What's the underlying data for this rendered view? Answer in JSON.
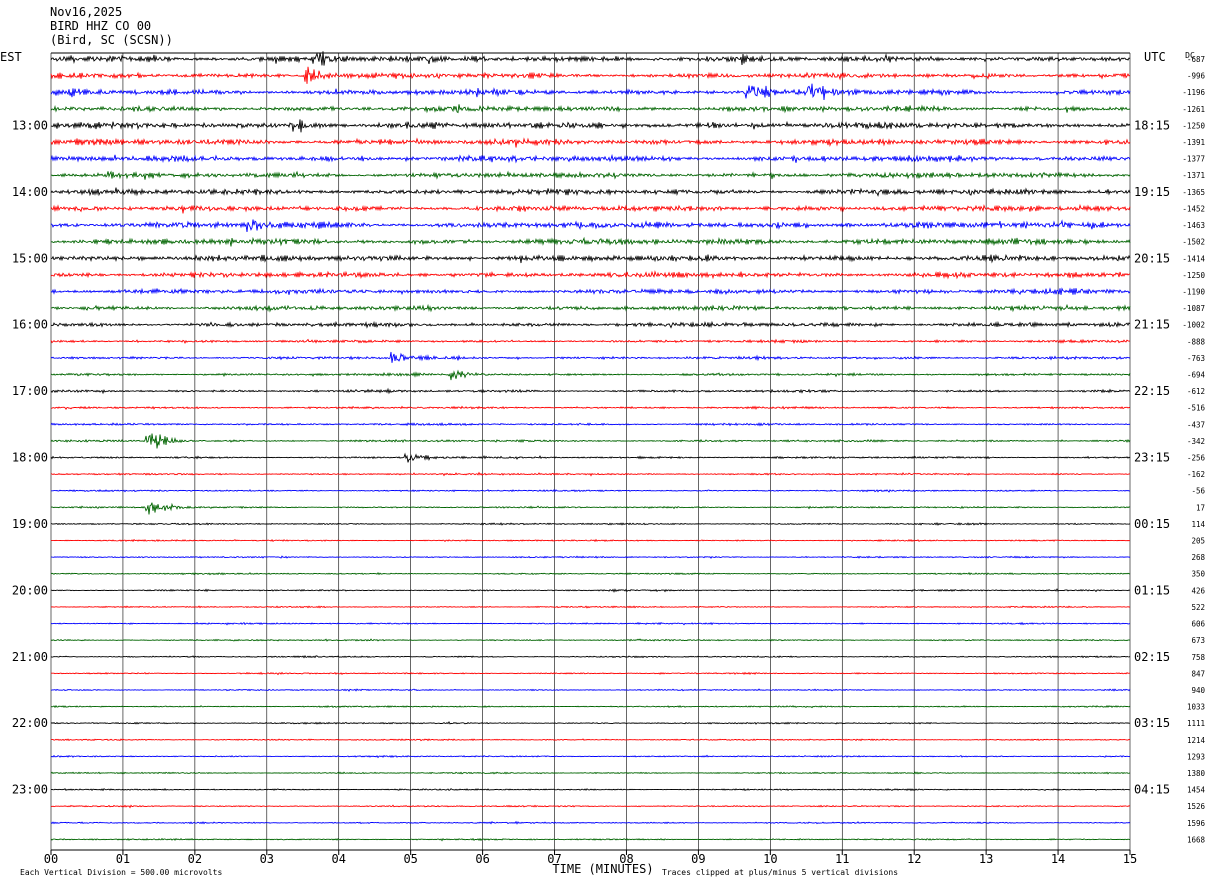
{
  "header": {
    "date": "Nov16,2025",
    "station": "BIRD HHZ CO 00",
    "location": "(Bird, SC (SCSN))"
  },
  "chart_data": {
    "type": "line",
    "title": "",
    "left_zone": "EST",
    "right_zone": "UTC",
    "dc_header": "DC",
    "xlabel": "TIME (MINUTES)",
    "x_ticks": [
      "00",
      "01",
      "02",
      "03",
      "04",
      "05",
      "06",
      "07",
      "08",
      "09",
      "10",
      "11",
      "12",
      "13",
      "14",
      "15"
    ],
    "xlim": [
      0,
      15
    ],
    "trace_colors": [
      "#000000",
      "#ff0000",
      "#0000ff",
      "#006400"
    ],
    "rows": 48,
    "left_hour_labels": [
      "13:00",
      "14:00",
      "15:00",
      "16:00",
      "17:00",
      "18:00",
      "19:00",
      "20:00",
      "21:00",
      "22:00",
      "23:00"
    ],
    "right_hour_labels": [
      "18:15",
      "19:15",
      "20:15",
      "21:15",
      "22:15",
      "23:15",
      "00:15",
      "01:15",
      "02:15",
      "03:15",
      "04:15"
    ],
    "dc_offsets": [
      "-687",
      "-996",
      "-1196",
      "-1261",
      "-1250",
      "-1391",
      "-1377",
      "-1371",
      "-1365",
      "-1452",
      "-1463",
      "-1502",
      "-1414",
      "-1250",
      "-1190",
      "-1087",
      "-1002",
      "-888",
      "-763",
      "-694",
      "-612",
      "-516",
      "-437",
      "-342",
      "-256",
      "-162",
      "-56",
      "17",
      "114",
      "205",
      "268",
      "350",
      "426",
      "522",
      "606",
      "673",
      "758",
      "847",
      "940",
      "1033",
      "1111",
      "1214",
      "1293",
      "1380",
      "1454",
      "1526",
      "1596",
      "1668"
    ],
    "row_amplitude": [
      3.4,
      3.0,
      3.2,
      3.0,
      3.6,
      3.4,
      3.4,
      3.0,
      3.2,
      3.2,
      3.6,
      3.4,
      3.4,
      3.0,
      2.8,
      2.6,
      2.4,
      1.5,
      1.6,
      1.4,
      1.4,
      1.2,
      1.2,
      1.2,
      1.1,
      1.0,
      0.9,
      0.9,
      0.9,
      0.8,
      0.8,
      0.8,
      0.8,
      0.8,
      0.8,
      0.8,
      0.8,
      0.8,
      0.8,
      0.8,
      0.8,
      0.8,
      0.8,
      0.8,
      0.8,
      0.8,
      0.8,
      0.8
    ],
    "events": [
      {
        "row": 0,
        "minute": 3.7,
        "amp": 3.4
      },
      {
        "row": 1,
        "minute": 3.6,
        "amp": 3.0
      },
      {
        "row": 2,
        "minute": 9.7,
        "amp": 4.5
      },
      {
        "row": 2,
        "minute": 10.6,
        "amp": 3.5
      },
      {
        "row": 4,
        "minute": 3.4,
        "amp": 2.5
      },
      {
        "row": 10,
        "minute": 2.8,
        "amp": 2.5
      },
      {
        "row": 18,
        "minute": 4.8,
        "amp": 2.5
      },
      {
        "row": 19,
        "minute": 5.6,
        "amp": 3.0
      },
      {
        "row": 23,
        "minute": 1.4,
        "amp": 4.0
      },
      {
        "row": 24,
        "minute": 5.0,
        "amp": 2.2
      },
      {
        "row": 27,
        "minute": 1.4,
        "amp": 3.5
      }
    ],
    "footer_left": "Each Vertical Division =  500.00 microvolts",
    "footer_right": "Traces clipped at plus/minus 5 vertical divisions"
  }
}
